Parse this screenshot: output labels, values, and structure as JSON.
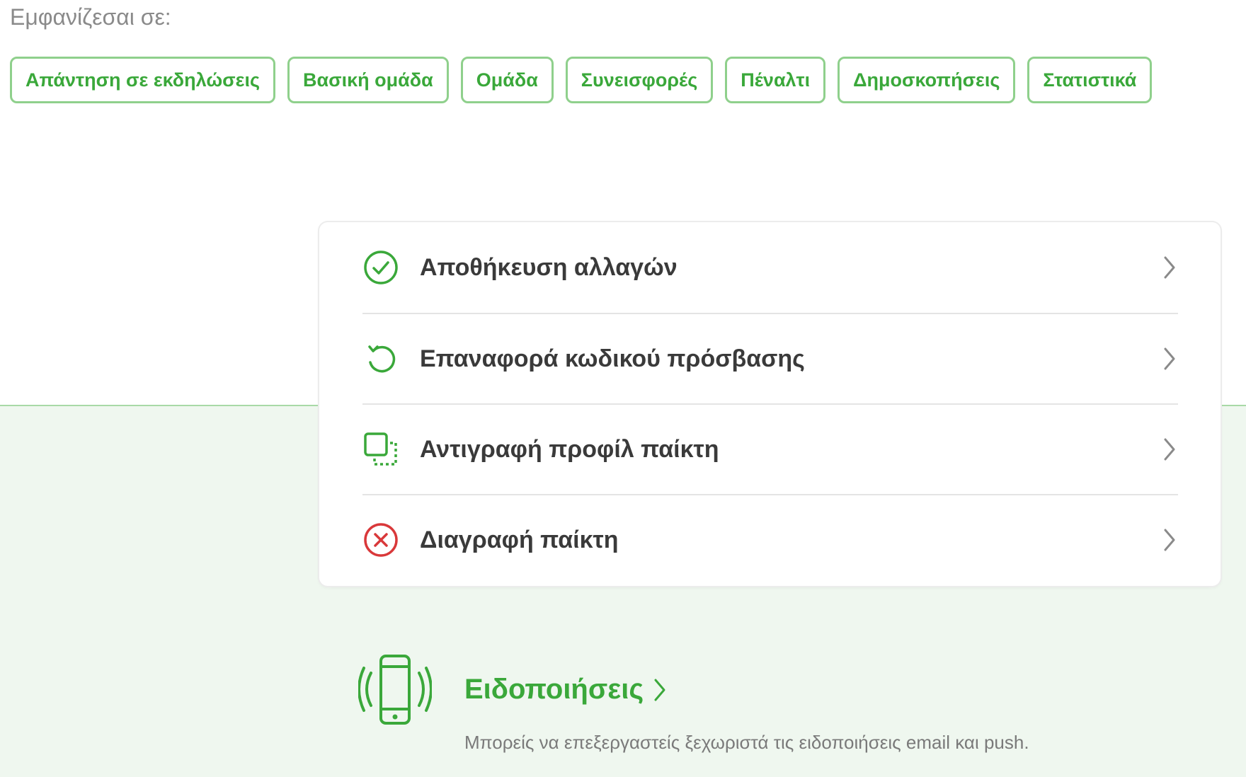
{
  "appear_label": "Εμφανίζεσαι σε:",
  "chips": [
    {
      "label": "Απάντηση σε εκδηλώσεις"
    },
    {
      "label": "Βασική ομάδα"
    },
    {
      "label": "Ομάδα"
    },
    {
      "label": "Συνεισφορές"
    },
    {
      "label": "Πέναλτι"
    },
    {
      "label": "Δημοσκοπήσεις"
    },
    {
      "label": "Στατιστικά"
    }
  ],
  "menu": [
    {
      "label": "Αποθήκευση αλλαγών",
      "icon": "check-circle-icon"
    },
    {
      "label": "Επαναφορά κωδικού πρόσβασης",
      "icon": "reset-arrow-icon"
    },
    {
      "label": "Αντιγραφή προφίλ παίκτη",
      "icon": "copy-icon"
    },
    {
      "label": "Διαγραφή παίκτη",
      "icon": "delete-x-circle-icon"
    }
  ],
  "notifications": {
    "title": "Ειδοποιήσεις",
    "subtitle": "Μπορείς να επεξεργαστείς ξεχωριστά τις ειδοποιήσεις email και push.",
    "icon": "phone-vibrate-icon"
  },
  "colors": {
    "accent": "#3aa83a",
    "chip_border": "#8fd08c",
    "danger": "#d9383a",
    "band": "#eff7ef"
  }
}
